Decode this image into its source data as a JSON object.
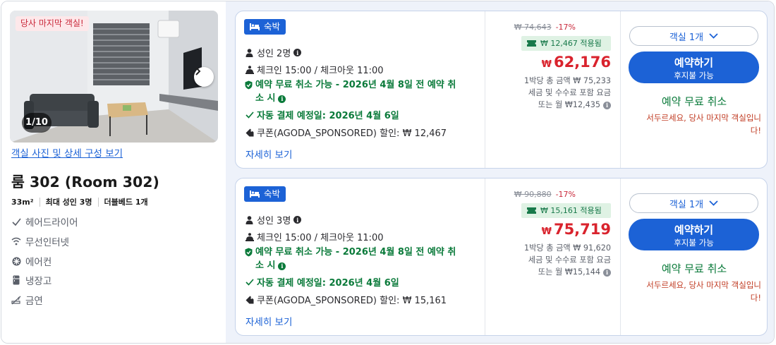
{
  "room": {
    "last_room_tag": "당사 마지막 객실!",
    "photo_counter": "1/10",
    "view_photos_link": "객실 사진 및 상세 구성 보기",
    "title": "룸 302 (Room 302)",
    "size": "33m²",
    "max_occupancy": "최대 성인 3명",
    "bed": "더블베드 1개",
    "amenities": [
      {
        "label": "헤어드라이어",
        "icon": "check-icon"
      },
      {
        "label": "무선인터넷",
        "icon": "wifi-icon"
      },
      {
        "label": "에어컨",
        "icon": "snowflake-icon"
      },
      {
        "label": "냉장고",
        "icon": "fridge-icon"
      },
      {
        "label": "금연",
        "icon": "no-smoking-icon"
      }
    ]
  },
  "offers": [
    {
      "badge": "숙박",
      "guests": "성인 2명",
      "checkin": "체크인 15:00 / 체크아웃 11:00",
      "free_cancel_line1": "예약 무료 취소 가능 - 2026년 4월 8일 전 예약 취",
      "free_cancel_line2": "소 시",
      "auto_pay": "자동 결제 예정일: 2026년 4월 6일",
      "coupon": "쿠폰(AGODA_SPONSORED) 할인: ₩ 12,467",
      "details_link": "자세히 보기",
      "original_price": "₩ 74,643",
      "discount": "-17%",
      "applied": "₩ 12,467 적용됨",
      "currency": "₩",
      "price": "62,176",
      "per_night_total": "1박당 총 금액 ₩ 75,233",
      "tax_note": "세금 및 수수료 포함 요금",
      "monthly": "또는 월 ₩12,435",
      "rooms_select": "객실 1개",
      "reserve_label": "예약하기",
      "reserve_sub": "후지불 가능",
      "free_cancel_label": "예약 무료 취소",
      "hurry_line1": "서두르세요, 당사 마지막 객실입니",
      "hurry_line2": "다!"
    },
    {
      "badge": "숙박",
      "guests": "성인 3명",
      "checkin": "체크인 15:00 / 체크아웃 11:00",
      "free_cancel_line1": "예약 무료 취소 가능 - 2026년 4월 8일 전 예약 취",
      "free_cancel_line2": "소 시",
      "auto_pay": "자동 결제 예정일: 2026년 4월 6일",
      "coupon": "쿠폰(AGODA_SPONSORED) 할인: ₩ 15,161",
      "details_link": "자세히 보기",
      "original_price": "₩ 90,880",
      "discount": "-17%",
      "applied": "₩ 15,161 적용됨",
      "currency": "₩",
      "price": "75,719",
      "per_night_total": "1박당 총 금액 ₩ 91,620",
      "tax_note": "세금 및 수수료 포함 요금",
      "monthly": "또는 월 ₩15,144",
      "rooms_select": "객실 1개",
      "reserve_label": "예약하기",
      "reserve_sub": "후지불 가능",
      "free_cancel_label": "예약 무료 취소",
      "hurry_line1": "서두르세요, 당사 마지막 객실입니",
      "hurry_line2": "다!"
    }
  ],
  "colors": {
    "accent": "#1c62d6",
    "price": "#d9232d",
    "success": "#0a7a3a",
    "warning": "#c03b22"
  }
}
